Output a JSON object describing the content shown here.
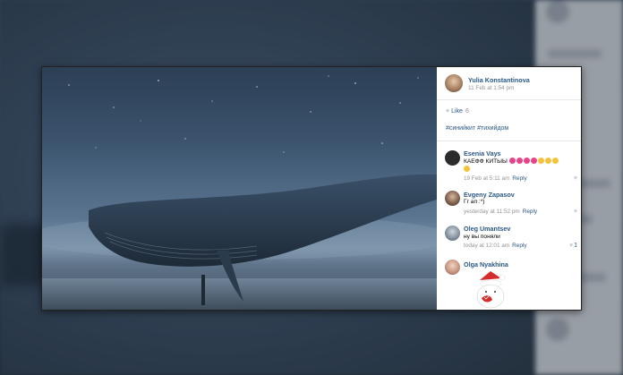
{
  "post": {
    "author": "Yulia Konstantinova",
    "date": "11 Feb at 1:54 pm",
    "like_label": "Like",
    "like_count": "6",
    "hashtags": "#синийкит #тихийдом"
  },
  "comments": [
    {
      "name": "Esenia Vays",
      "text": "КАЕФФ КИТЫЫ",
      "time": "19 Feb at 5:11 am",
      "reply": "Reply",
      "like_count": ""
    },
    {
      "name": "Evgeny Zapasov",
      "text": "Гг ап :*)",
      "time": "yesterday at 11:52 pm",
      "reply": "Reply",
      "like_count": ""
    },
    {
      "name": "Oleg Umantsev",
      "text": "ну вы поняли",
      "time": "today at 12:01 am",
      "reply": "Reply",
      "like_count": "1"
    },
    {
      "name": "Olga Nyakhina",
      "text": "",
      "time": "",
      "reply": "",
      "like_count": ""
    }
  ],
  "icons": {
    "heart": "heart-icon",
    "sticker": "santa-bear-sticker"
  },
  "colors": {
    "link": "#2a5885",
    "meta": "#939393",
    "emoji_heart": "#e8448a",
    "emoji_laugh": "#f5c33b"
  }
}
